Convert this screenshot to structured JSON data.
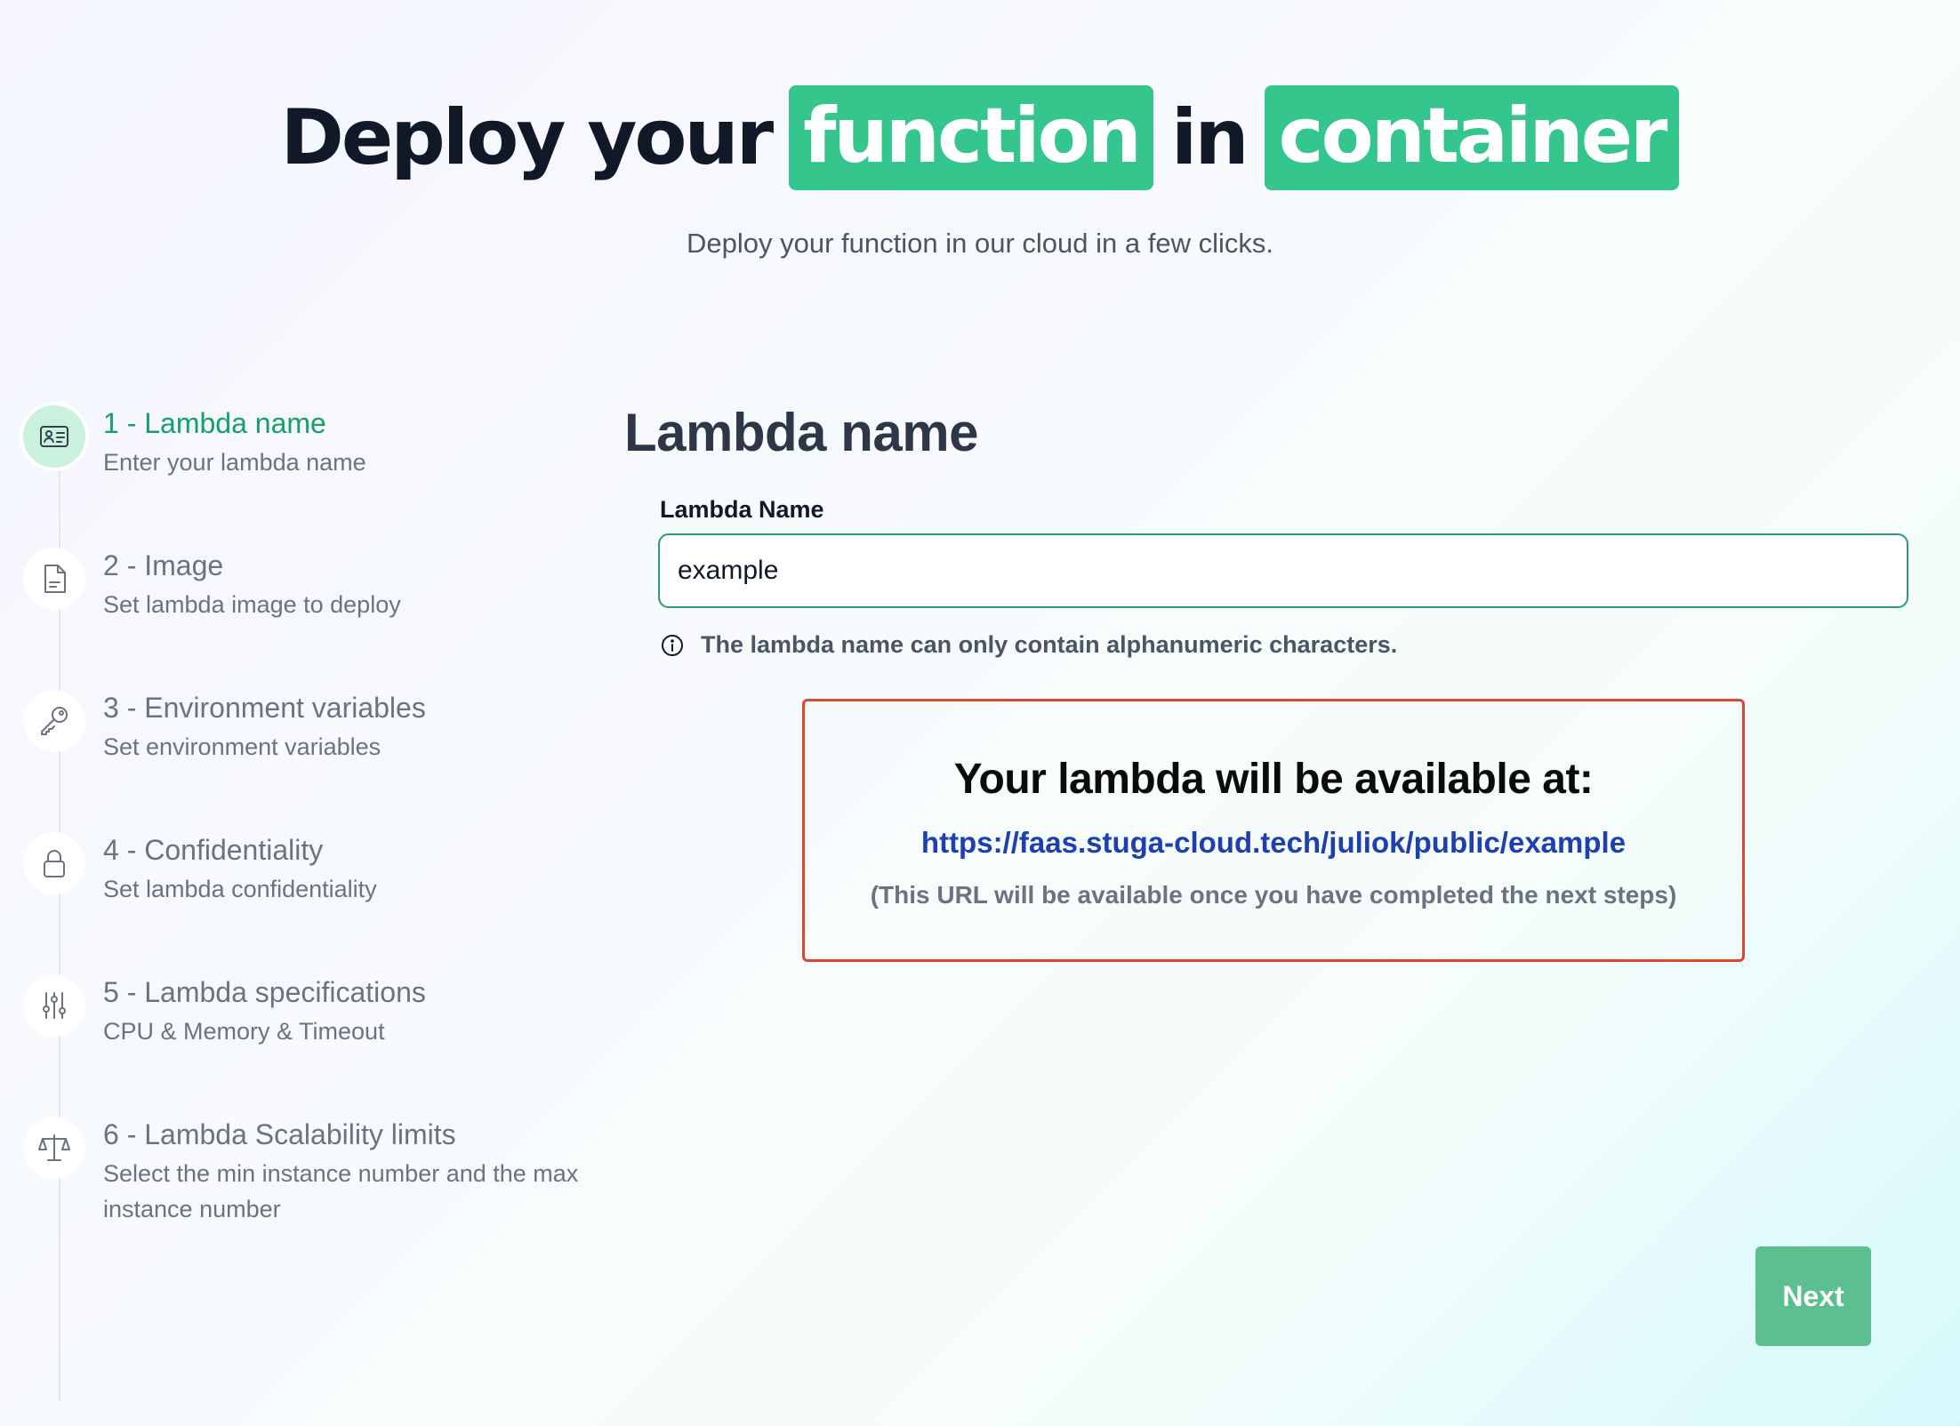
{
  "hero": {
    "title_part1": "Deploy your",
    "title_highlight1": "function",
    "title_part2": "in",
    "title_highlight2": "container",
    "subtitle": "Deploy your function in our cloud in a few clicks.",
    "accent_color": "#34c68c"
  },
  "stepper": {
    "active_index": 0,
    "active_color": "#16a068",
    "steps": [
      {
        "title": "1 - Lambda name",
        "description": "Enter your lambda name",
        "icon": "id-card-icon"
      },
      {
        "title": "2 - Image",
        "description": "Set lambda image to deploy",
        "icon": "file-icon"
      },
      {
        "title": "3 - Environment variables",
        "description": "Set environment variables",
        "icon": "key-icon"
      },
      {
        "title": "4 - Confidentiality",
        "description": "Set lambda confidentiality",
        "icon": "lock-icon"
      },
      {
        "title": "5 - Lambda specifications",
        "description": "CPU & Memory & Timeout",
        "icon": "sliders-icon"
      },
      {
        "title": "6 - Lambda Scalability limits",
        "description": "Select the min instance number and the max instance number",
        "icon": "scale-icon"
      }
    ]
  },
  "main": {
    "section_title": "Lambda name",
    "field_label": "Lambda Name",
    "field_value": "example",
    "hint": "The lambda name can only contain alphanumeric characters.",
    "hint_icon": "info-icon"
  },
  "availability": {
    "title": "Your lambda will be available at:",
    "url": "https://faas.stuga-cloud.tech/juliok/public/example",
    "note": "(This URL will be available once you have completed the next steps)",
    "border_color": "#e0452f"
  },
  "actions": {
    "next_label": "Next"
  }
}
